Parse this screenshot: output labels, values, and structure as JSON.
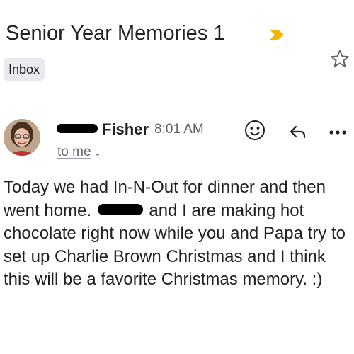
{
  "email": {
    "subject": "Senior Year Memories 1",
    "label": "Inbox",
    "sender": {
      "name": "Fisher",
      "time": "8:01 AM",
      "recipient": "to me"
    },
    "body": {
      "part1": "Today we had In-N-Out for dinner and then went home. ",
      "part2": " and I are making hot chocolate right now while you and Papa try to set up Charlie Brown Christmas and I think this will be a favorite Christmas memory. :)"
    }
  },
  "colors": {
    "importance_marker": "#f4b400",
    "label_bg": "#e8eaed",
    "text_primary": "#202124",
    "text_secondary": "#5f6368"
  },
  "icons": {
    "importance": "importance-marker-icon",
    "star": "star-outline-icon",
    "emoji": "smiley-face-icon",
    "reply": "reply-arrow-icon",
    "more": "more-horizontal-icon",
    "recipient_details": "chevron-down-icon"
  }
}
